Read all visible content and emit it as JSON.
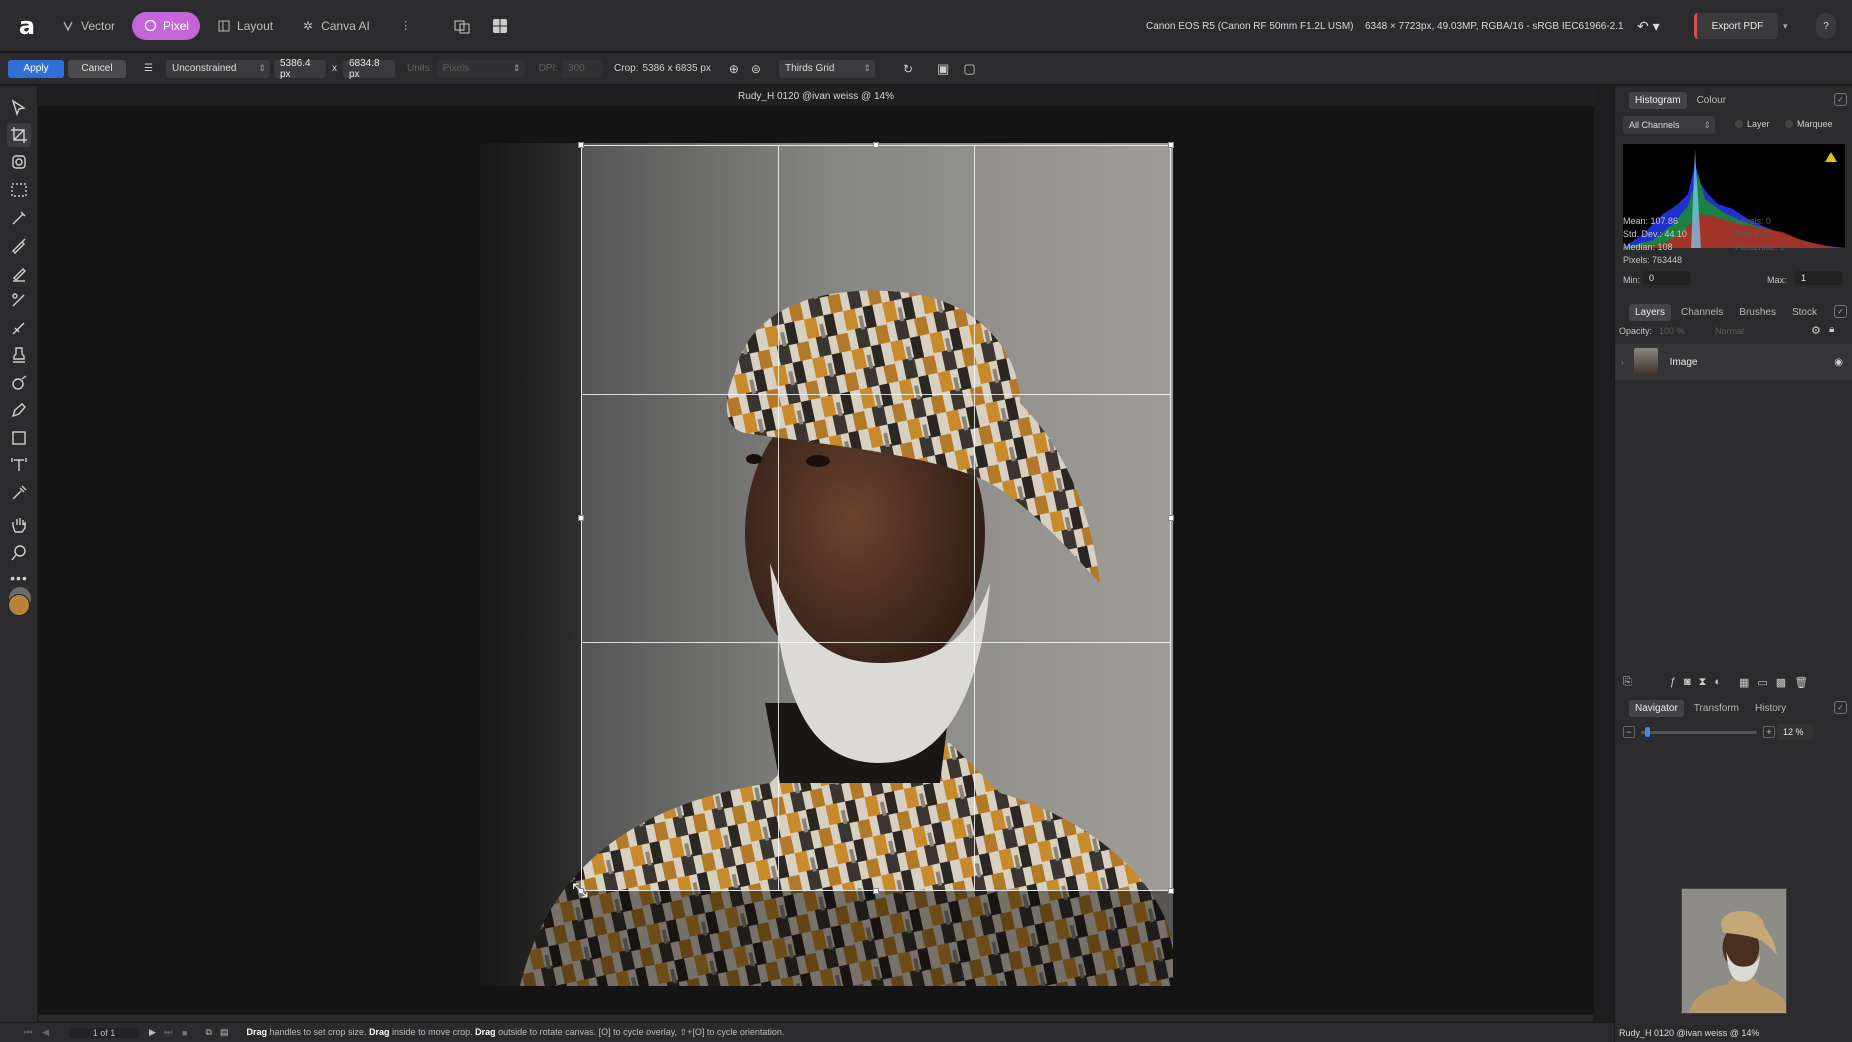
{
  "app": {
    "personas": [
      {
        "label": "Vector",
        "icon": "vector-persona-icon"
      },
      {
        "label": "Pixel",
        "icon": "pixel-persona-icon"
      },
      {
        "label": "Layout",
        "icon": "layout-persona-icon"
      },
      {
        "label": "Canva AI",
        "icon": "canva-ai-icon"
      }
    ],
    "active_persona": "Pixel",
    "camera_info": "Canon EOS R5 (Canon RF 50mm F1.2L USM)",
    "doc_info": "6348 × 7723px, 49.03MP, RGBA/16 - sRGB IEC61966-2.1",
    "export_label": "Export PDF",
    "accent_color": "#c466d8",
    "apply_color": "#2f6fd6"
  },
  "context": {
    "apply_label": "Apply",
    "cancel_label": "Cancel",
    "mode": "Unconstrained",
    "width": "5386.4 px",
    "times": "x",
    "height": "6834.8 px",
    "units_label": "Units:",
    "units_value": "Pixels",
    "dpi_label": "DPI:",
    "dpi_value": "300",
    "crop_label": "Crop:",
    "crop_value": "5386 x 6835 px",
    "overlay": "Thirds Grid"
  },
  "document": {
    "title": "Rudy_H 0120 @ivan weiss @ 14%"
  },
  "tools": [
    "move-tool-icon",
    "crop-tool-icon",
    "view-tool-icon",
    "rect-selection-icon",
    "selection-brush-icon",
    "paint-brush-icon",
    "pixel-brush-icon",
    "retouch-icon",
    "erase-brush-icon",
    "clone-stamp-icon",
    "dodge-icon",
    "pen-icon",
    "shape-tool-icon",
    "text-tool-icon",
    "eyedropper-icon",
    "hand-tool-icon",
    "zoom-tool-icon",
    "more-tools-icon"
  ],
  "histogram": {
    "tabs": [
      "Histogram",
      "Colour"
    ],
    "channel": "All Channels",
    "layer_label": "Layer",
    "marquee_label": "Marquee",
    "mean": "Mean: 107.86",
    "std": "Std. Dev.: 44.10",
    "median": "Median: 108",
    "pixels": "Pixels: 763448",
    "levels": "Levels: 0",
    "pixels_sel": "Pixels: 0",
    "percentile": "Percentile: 0",
    "min_label": "Min:",
    "min_value": "0",
    "max_label": "Max:",
    "max_value": "1"
  },
  "layers": {
    "tabs": [
      "Layers",
      "Channels",
      "Brushes",
      "Stock"
    ],
    "opacity_label": "Opacity:",
    "opacity_value": "100 %",
    "blend": "Normal",
    "items": [
      {
        "name": "Image"
      }
    ]
  },
  "navigator": {
    "tabs": [
      "Navigator",
      "Transform",
      "History"
    ],
    "zoom": "12 %",
    "caption": "Rudy_H 0120 @ivan weiss @ 14%"
  },
  "status": {
    "page": "1 of 1",
    "hint_parts": [
      {
        "bold": "Drag",
        "text": " handles to set crop size. "
      },
      {
        "bold": "Drag",
        "text": " inside to move crop. "
      },
      {
        "bold": "Drag",
        "text": " outside to rotate canvas. [O] to cycle overlay, ⇧+[O] to cycle orientation."
      }
    ]
  }
}
